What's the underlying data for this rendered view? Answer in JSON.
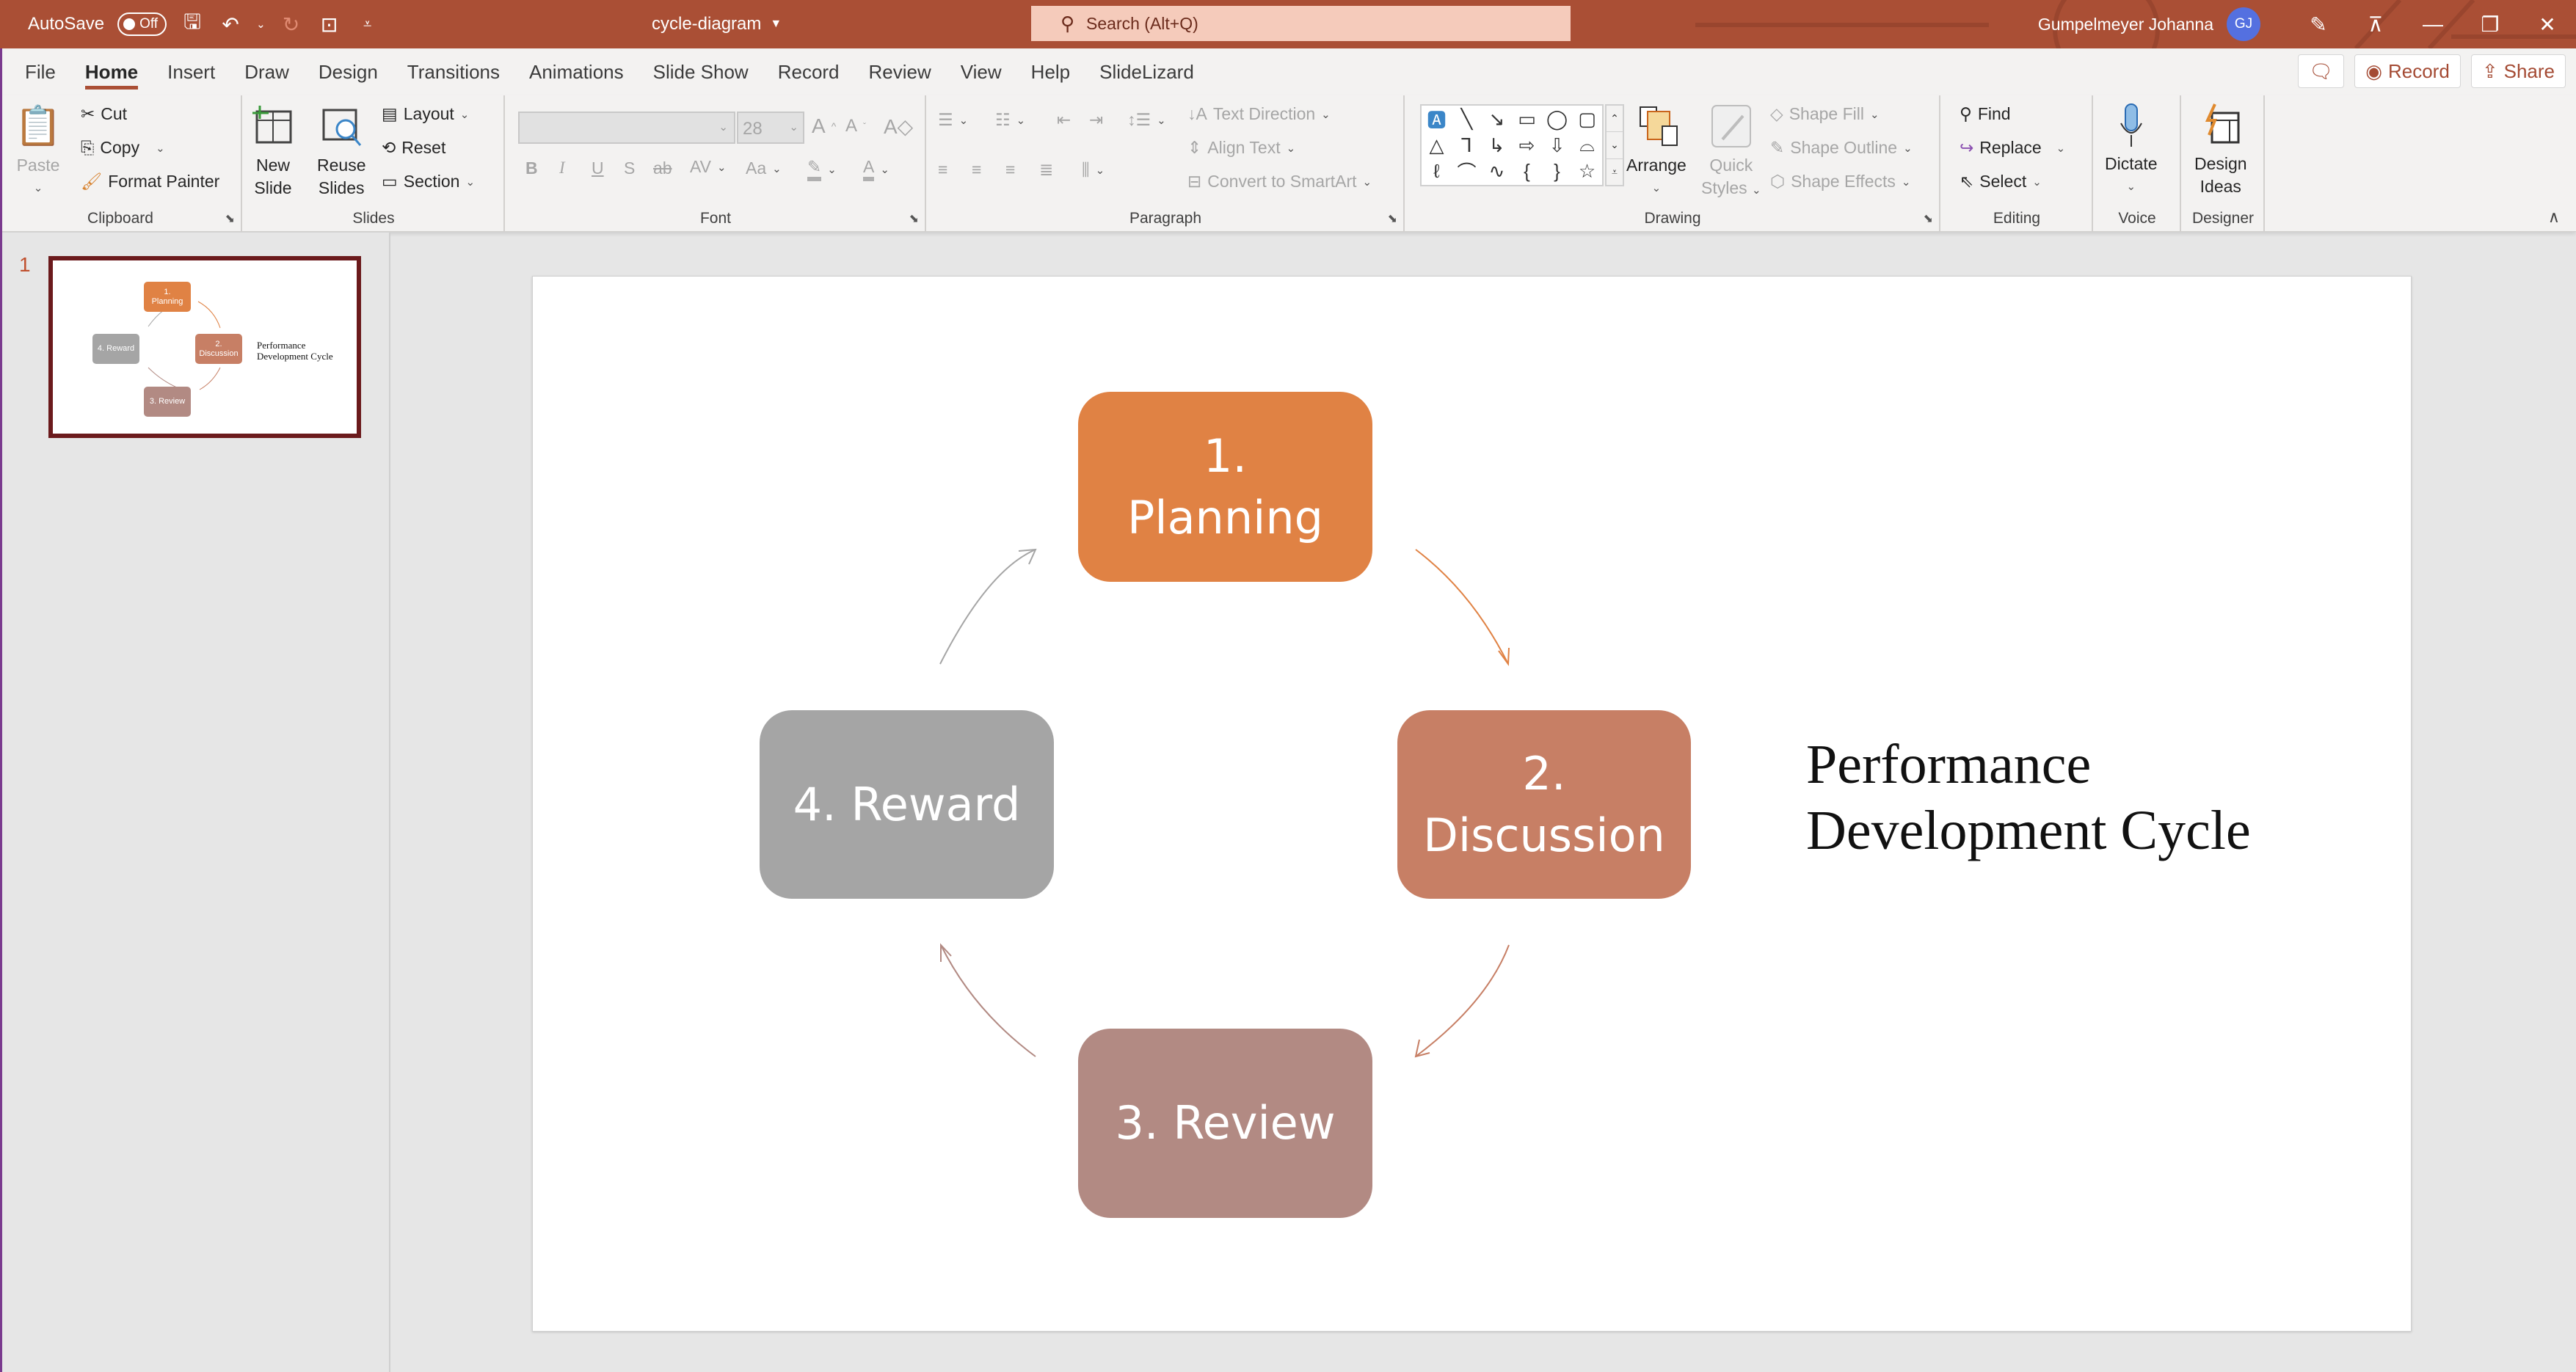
{
  "titlebar": {
    "autosave_label": "AutoSave",
    "autosave_state": "Off",
    "doc_title": "cycle-diagram",
    "search_placeholder": "Search (Alt+Q)",
    "user_name": "Gumpelmeyer Johanna",
    "user_initials": "GJ",
    "icons": [
      "save-icon",
      "undo-icon",
      "redo-icon",
      "present-icon",
      "customize-qat-icon",
      "coauthoring-icon",
      "ribbon-display-icon",
      "minimize-icon",
      "restore-icon",
      "close-icon"
    ]
  },
  "tabs": [
    {
      "label": "File"
    },
    {
      "label": "Home",
      "active": true
    },
    {
      "label": "Insert"
    },
    {
      "label": "Draw"
    },
    {
      "label": "Design"
    },
    {
      "label": "Transitions"
    },
    {
      "label": "Animations"
    },
    {
      "label": "Slide Show"
    },
    {
      "label": "Record"
    },
    {
      "label": "Review"
    },
    {
      "label": "View"
    },
    {
      "label": "Help"
    },
    {
      "label": "SlideLizard"
    }
  ],
  "tab_actions": {
    "comments_icon": "comment-icon",
    "record_label": "Record",
    "share_label": "Share"
  },
  "ribbon": {
    "clipboard": {
      "label": "Clipboard",
      "paste": "Paste",
      "cut": "Cut",
      "copy": "Copy",
      "format_painter": "Format Painter"
    },
    "slides": {
      "label": "Slides",
      "new_slide_1": "New",
      "new_slide_2": "Slide",
      "reuse_1": "Reuse",
      "reuse_2": "Slides",
      "layout": "Layout",
      "reset": "Reset",
      "section": "Section"
    },
    "font": {
      "label": "Font",
      "font_name": "",
      "font_size": "28",
      "bold": "B",
      "italic": "I",
      "underline": "U",
      "shadow": "S",
      "strike": "ab",
      "spacing": "AV",
      "case": "Aa",
      "grow": "A^",
      "shrink": "Aˇ"
    },
    "paragraph": {
      "label": "Paragraph",
      "text_direction": "Text Direction",
      "align_text": "Align Text",
      "smartart": "Convert to SmartArt"
    },
    "drawing": {
      "label": "Drawing",
      "arrange": "Arrange",
      "quick_1": "Quick",
      "quick_2": "Styles",
      "shape_fill": "Shape Fill",
      "shape_outline": "Shape Outline",
      "shape_effects": "Shape Effects"
    },
    "editing": {
      "label": "Editing",
      "find": "Find",
      "replace": "Replace",
      "select": "Select"
    },
    "voice": {
      "label": "Voice",
      "dictate": "Dictate"
    },
    "designer": {
      "label": "Designer",
      "design_1": "Design",
      "design_2": "Ideas"
    }
  },
  "thumbnails": [
    {
      "number": "1",
      "selected": true
    }
  ],
  "slide": {
    "title_line1": "Performance",
    "title_line2": "Development Cycle",
    "steps": [
      {
        "num": "1.",
        "label": "Planning",
        "color": "#e08244"
      },
      {
        "num": "2.",
        "label": "Discussion",
        "color": "#c77f65"
      },
      {
        "num": "3.",
        "label": "Review",
        "color": "#b28a83"
      },
      {
        "num": "4.",
        "label": "Reward",
        "color": "#a5a5a5"
      }
    ],
    "arrow_colors": {
      "planning_to_discussion": "#e08244",
      "discussion_to_review": "#c77f65",
      "review_to_reward": "#b28a83",
      "reward_to_planning": "#a5a5a5"
    }
  },
  "colors": {
    "accent": "#aa4f35",
    "selection": "#6b1a1c"
  }
}
